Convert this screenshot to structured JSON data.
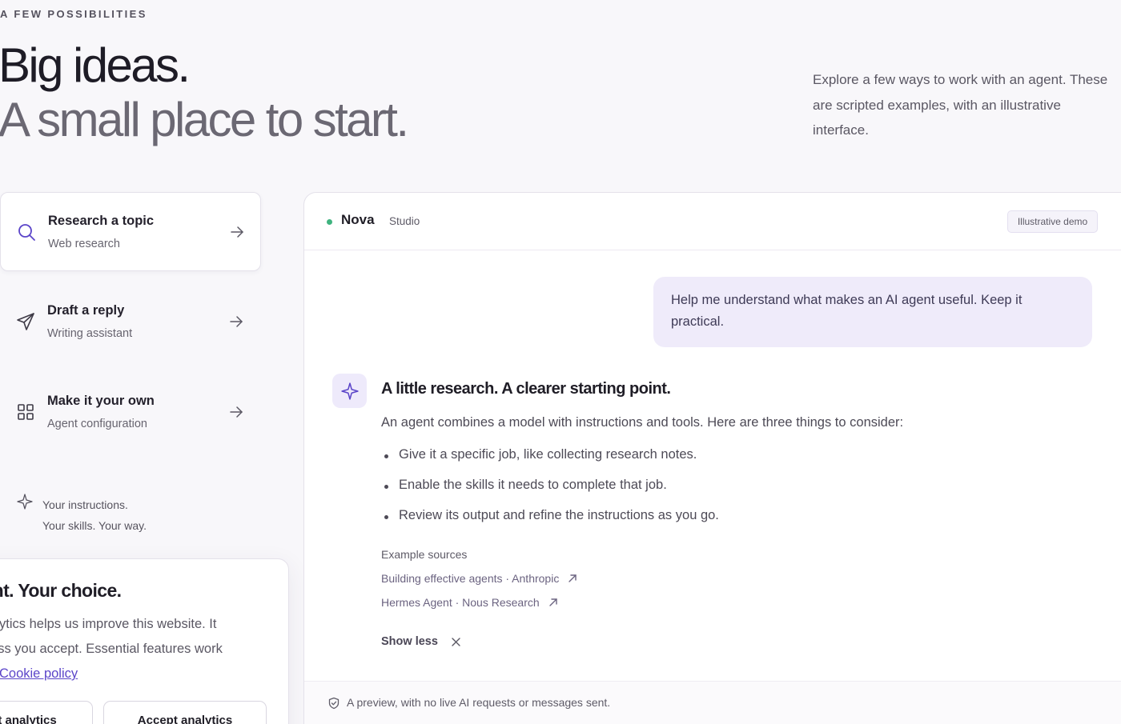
{
  "section": {
    "eyebrow": "A FEW POSSIBILITIES",
    "title_line1": "Big ideas.",
    "title_line2": "A small place to start.",
    "intro": "Explore a few ways to work with an agent. These are scripted examples, with an illustrative interface."
  },
  "tasks": [
    {
      "title": "Research a topic",
      "subtitle": "Web research",
      "icon": "search-icon",
      "active": true
    },
    {
      "title": "Draft a reply",
      "subtitle": "Writing assistant",
      "icon": "paper-plane-icon",
      "active": false
    },
    {
      "title": "Make it your own",
      "subtitle": "Agent configuration",
      "icon": "grid-icon",
      "active": false
    }
  ],
  "tagline": {
    "line1": "Your instructions.",
    "line2": "Your skills. Your way."
  },
  "cookie": {
    "title": "Insight. Your choice.",
    "text_line1": "Analytics helps us improve this website. It",
    "text_line2": "unless you accept. Essential features work",
    "policy_link": "Cookie policy",
    "reject_label": "Reject analytics",
    "accept_label": "Accept analytics"
  },
  "demo": {
    "agent_name": "Nova",
    "agent_context": "Studio",
    "badge": "Illustrative demo",
    "status_color": "#3fb37f",
    "user_message": "Help me understand what makes an AI agent useful. Keep it practical.",
    "response_title": "A little research. A clearer starting point.",
    "response_intro": "An agent combines a model with instructions and tools. Here are three things to consider:",
    "response_points": [
      "Give it a specific job, like collecting research notes.",
      "Enable the skills it needs to complete that job.",
      "Review its output and refine the instructions as you go."
    ],
    "sources_label": "Example sources",
    "sources": [
      "Building effective agents · Anthropic",
      "Hermes Agent · Nous Research"
    ],
    "show_less": "Show less",
    "footer_note": "A preview, with no live AI requests or messages sent."
  },
  "colors": {
    "accent": "#5b45c9",
    "user_bubble": "#efebfa",
    "background": "#f8f7fa"
  }
}
